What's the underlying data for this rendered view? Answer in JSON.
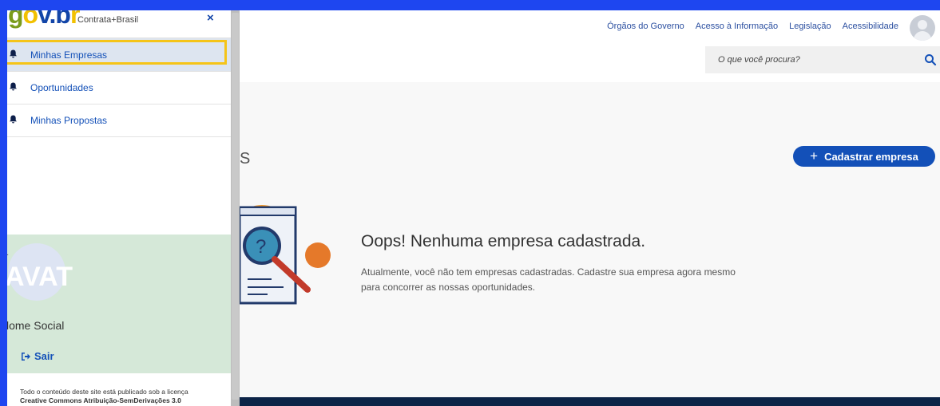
{
  "colors": {
    "accent": "#1e46f0",
    "primary": "#1350b8",
    "highlight": "#f5c418",
    "profile_bg": "#d5e8d8",
    "footer": "#0c2447"
  },
  "drawer": {
    "logo": {
      "g": "g",
      "o": "o",
      "v": "v",
      "dot": ".",
      "b": "b",
      "r": "r"
    },
    "app_name": "Contrata+Brasil",
    "close_label": "×",
    "menu": [
      {
        "label": "Minhas Empresas",
        "icon": "bell-icon",
        "active": true
      },
      {
        "label": "Oportunidades",
        "icon": "bell-icon",
        "active": false
      },
      {
        "label": "Minhas Propostas",
        "icon": "bell-icon",
        "active": false
      }
    ],
    "profile": {
      "avatar_text": "AVAT",
      "name": "lome Social",
      "logout_label": "Sair",
      "logout_icon": "sign-out-icon"
    },
    "license": {
      "line1": "Todo o conteúdo deste site está publicado sob a licença",
      "line2": "Creative Commons Atribuição-SemDerivações 3.0"
    }
  },
  "header": {
    "links": [
      "Órgãos do Governo",
      "Acesso à Informação",
      "Legislação",
      "Acessibilidade"
    ],
    "search_placeholder": "O que você procura?",
    "search_icon": "search-icon"
  },
  "main": {
    "title_fragment": "S",
    "add_button": {
      "icon": "+",
      "label": "Cadastrar empresa"
    },
    "empty_title": "Oops! Nenhuma empresa cadastrada.",
    "empty_text": "Atualmente, você não tem empresas cadastradas. Cadastre sua empresa agora mesmo para concorrer as nossas oportunidades."
  }
}
